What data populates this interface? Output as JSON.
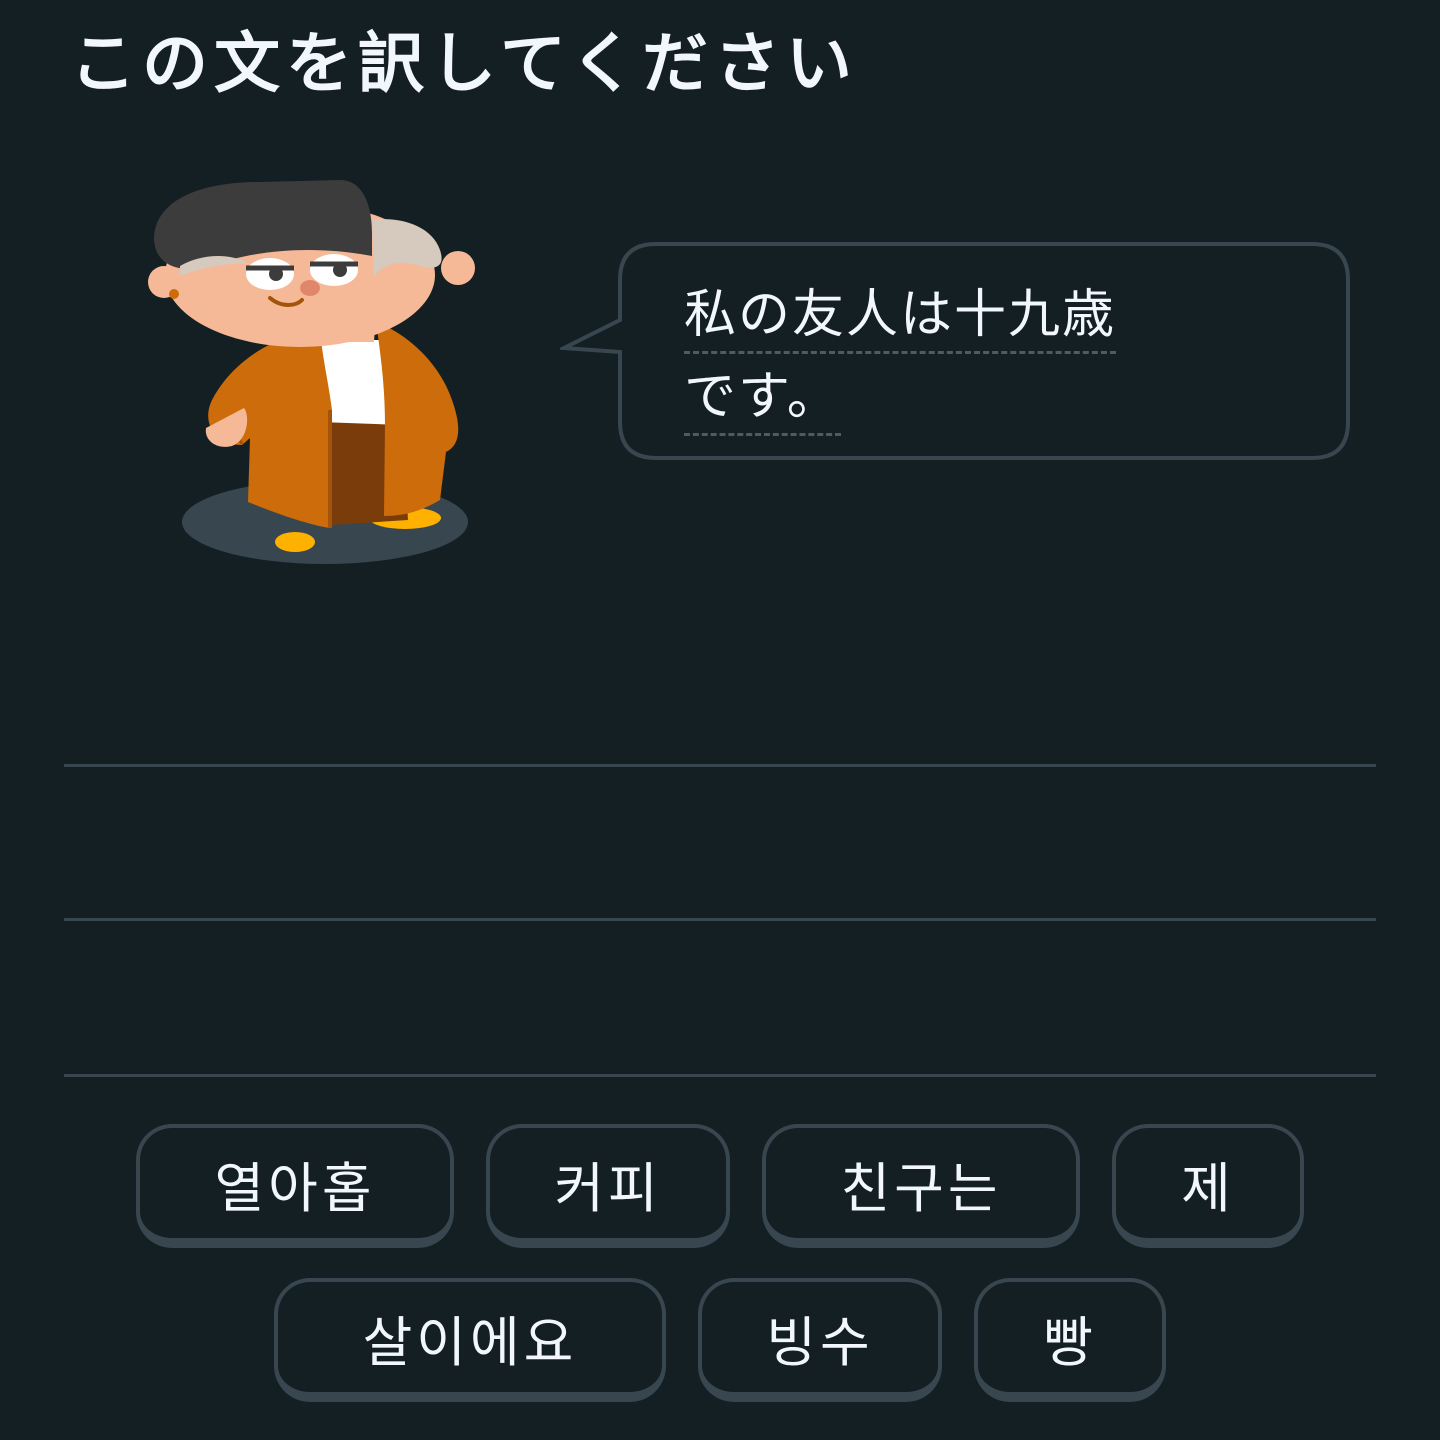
{
  "header": {
    "instruction": "この文を訳してください"
  },
  "prompt": {
    "line1": "私の友人は十九歳",
    "line2": "です。"
  },
  "word_bank": [
    "열아홉",
    "커피",
    "친구는",
    "제",
    "살이에요",
    "빙수",
    "빵"
  ],
  "colors": {
    "background": "#141f23",
    "border": "#37464f",
    "text": "#f1f7fb"
  }
}
